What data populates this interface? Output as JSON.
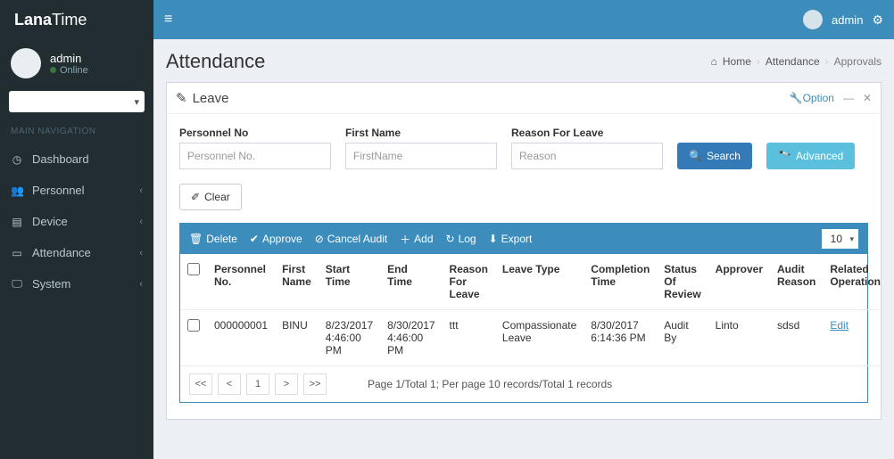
{
  "brand": {
    "bold": "Lana",
    "light": "Time"
  },
  "topnav": {
    "user": "admin"
  },
  "sidebar": {
    "user": {
      "name": "admin",
      "status": "Online"
    },
    "navheader": "MAIN NAVIGATION",
    "items": [
      {
        "icon": "◐",
        "label": "Dashboard",
        "has_chevron": false
      },
      {
        "icon": "👥",
        "label": "Personnel",
        "has_chevron": true
      },
      {
        "icon": "▤",
        "label": "Device",
        "has_chevron": true
      },
      {
        "icon": "▭",
        "label": "Attendance",
        "has_chevron": true
      },
      {
        "icon": "🖵",
        "label": "System",
        "has_chevron": true
      }
    ]
  },
  "page": {
    "title": "Attendance",
    "breadcrumb": {
      "home": "Home",
      "mid": "Attendance",
      "last": "Approvals"
    }
  },
  "panel": {
    "title": "Leave",
    "option_label": "Option",
    "filters": {
      "pno_label": "Personnel No",
      "pno_ph": "Personnel No.",
      "fname_label": "First Name",
      "fname_ph": "FirstName",
      "reason_label": "Reason For Leave",
      "reason_ph": "Reason"
    },
    "buttons": {
      "search": "Search",
      "advanced": "Advanced",
      "clear": "Clear"
    },
    "toolbar": {
      "delete": "Delete",
      "approve": "Approve",
      "cancel_audit": "Cancel Audit",
      "add": "Add",
      "log": "Log",
      "export": "Export"
    },
    "perpage": "10",
    "columns": {
      "pno": "Personnel No.",
      "fname": "First Name",
      "start": "Start Time",
      "end": "End Time",
      "reason": "Reason For Leave",
      "type": "Leave Type",
      "comp": "Completion Time",
      "status": "Status Of Review",
      "approver": "Approver",
      "audit": "Audit Reason",
      "op": "Related Operation"
    },
    "rows": [
      {
        "pno": "000000001",
        "fname": "BINU",
        "start": "8/23/2017 4:46:00 PM",
        "end": "8/30/2017 4:46:00 PM",
        "reason": "ttt",
        "type": "Compassionate Leave",
        "comp": "8/30/2017 6:14:36 PM",
        "status": "Audit By",
        "approver": "Linto",
        "audit": "sdsd",
        "op": "Edit"
      }
    ],
    "pager": {
      "first": "<<",
      "prev": "<",
      "page": "1",
      "next": ">",
      "last": ">>",
      "info": "Page 1/Total 1; Per page 10 records/Total 1 records"
    }
  }
}
